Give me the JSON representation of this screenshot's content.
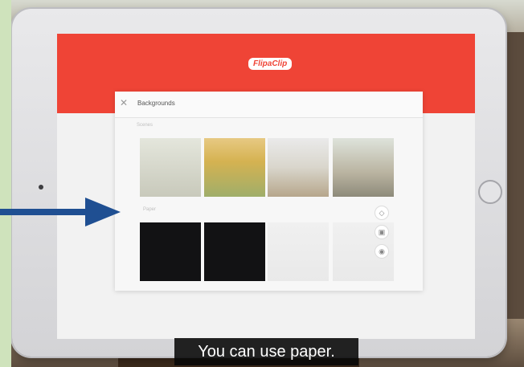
{
  "app": {
    "logo_text": "FlipaClip",
    "panel_title": "Backgrounds"
  },
  "sections": {
    "scenes_label": "Scenes",
    "paper_label": "Paper"
  },
  "scenes": [
    {
      "name": "scene-thumb-1"
    },
    {
      "name": "scene-thumb-2"
    },
    {
      "name": "scene-thumb-3"
    },
    {
      "name": "scene-thumb-4"
    }
  ],
  "paper": [
    {
      "name": "paper-thumb-black-1"
    },
    {
      "name": "paper-thumb-black-2"
    },
    {
      "name": "paper-thumb-white-1"
    },
    {
      "name": "paper-thumb-white-2"
    }
  ],
  "tools": [
    {
      "icon": "fill-icon"
    },
    {
      "icon": "image-icon"
    },
    {
      "icon": "camera-icon"
    }
  ],
  "subtitle": "You can use paper.",
  "colors": {
    "accent": "#ef4436",
    "arrow": "#1f4f92",
    "side_panel": "#cfe3bc"
  }
}
